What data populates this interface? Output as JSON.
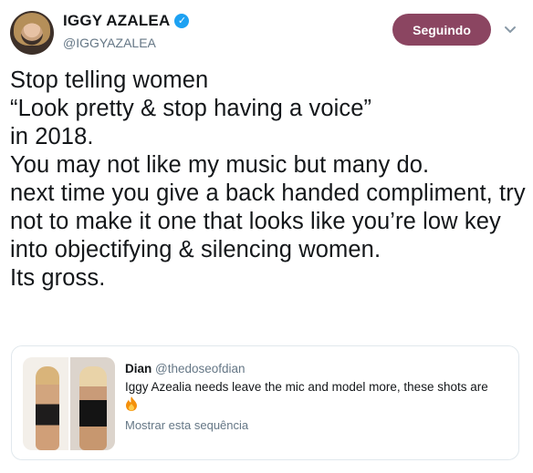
{
  "user": {
    "display_name": "IGGY AZALEA",
    "handle": "@IGGYAZALEA",
    "verified": true
  },
  "follow_button": {
    "label": "Seguindo",
    "color": "#8b4561"
  },
  "tweet": {
    "text": "Stop telling women\n“Look pretty & stop having a voice”\nin 2018.\nYou may not like my music but many do.\nnext time you give a back handed compliment, try not to make it one that looks like you’re low key into objectifying & silencing women.\nIts gross."
  },
  "quoted_tweet": {
    "display_name": "Dian",
    "handle": "@thedoseofdian",
    "text": "Iggy Azealia needs leave the mic and model more, these shots are",
    "emoji": "fire-icon",
    "show_thread": "Mostrar esta sequência"
  },
  "colors": {
    "verified": "#1da1f2",
    "muted": "#657786",
    "border": "#e1e8ed"
  }
}
